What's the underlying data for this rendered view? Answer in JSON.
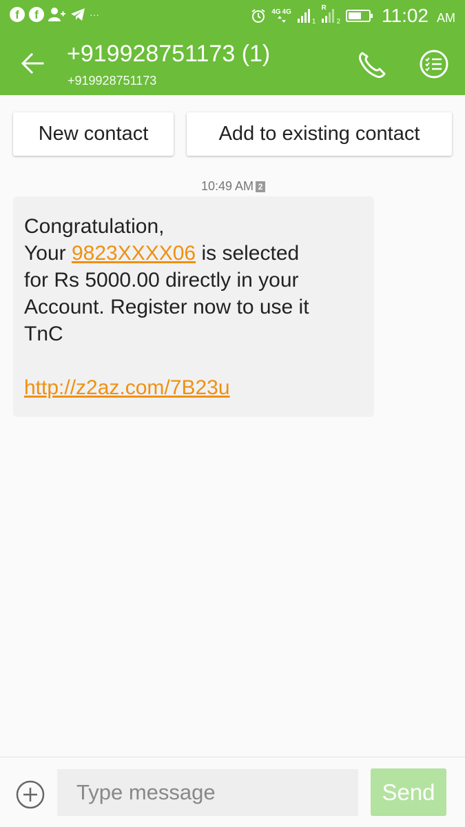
{
  "status_bar": {
    "time": "11:02",
    "ampm": "AM",
    "more": "···",
    "network_1": "4G",
    "network_2": "4G",
    "roaming": "R",
    "sim_1": "1",
    "sim_2": "2",
    "icons": [
      "facebook-icon",
      "facebook-icon",
      "add-person-icon",
      "telegram-icon",
      "alarm-icon",
      "signal-icon",
      "battery-icon"
    ]
  },
  "app_bar": {
    "title": "+919928751173 (1)",
    "subtitle": "+919928751173",
    "icons": [
      "back-arrow-icon",
      "phone-icon",
      "checklist-menu-icon"
    ],
    "accent_color": "#6bbd3a"
  },
  "contact_actions": {
    "new_contact": "New contact",
    "add_existing": "Add to existing contact"
  },
  "message": {
    "timestamp": "10:49 AM",
    "sim_badge": "2",
    "lines": {
      "l1": "Congratulation,",
      "l2_prefix": "Your ",
      "l2_link": "9823XXXX06",
      "l2_suffix": " is selected",
      "l3": "for Rs 5000.00 directly in your",
      "l4": "Account. Register now to use it",
      "l5": "TnC"
    },
    "url": "http://z2az.com/7B23u",
    "link_color": "#f0900f"
  },
  "composer": {
    "placeholder": "Type message",
    "send_label": "Send",
    "attach_icon": "plus-circle-icon"
  }
}
